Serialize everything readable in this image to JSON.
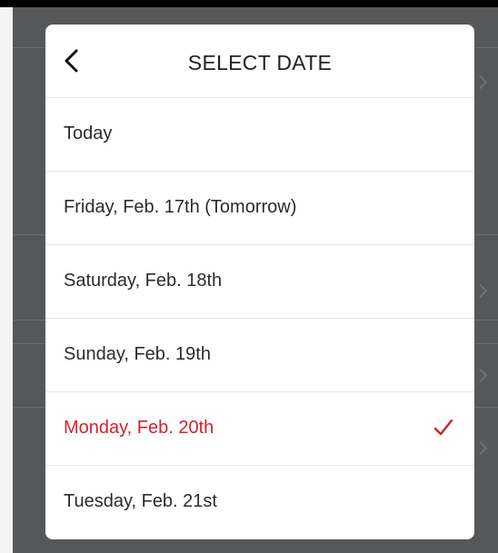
{
  "modal": {
    "title": "SELECT DATE",
    "back_icon": "chevron-left-icon",
    "selected_icon": "checkmark-icon",
    "accent_color": "#d71f2a",
    "options": [
      {
        "label": "Today",
        "selected": false
      },
      {
        "label": "Friday, Feb. 17th (Tomorrow)",
        "selected": false
      },
      {
        "label": "Saturday, Feb. 18th",
        "selected": false
      },
      {
        "label": "Sunday, Feb. 19th",
        "selected": false
      },
      {
        "label": "Monday, Feb. 20th",
        "selected": true
      },
      {
        "label": "Tuesday, Feb. 21st",
        "selected": false
      }
    ]
  }
}
